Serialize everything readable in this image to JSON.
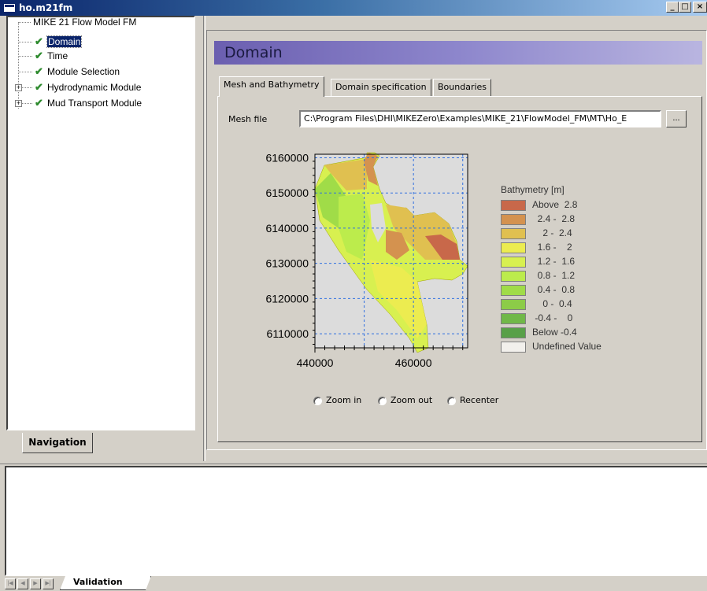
{
  "window": {
    "title": "ho.m21fm",
    "minimize": "_",
    "maximize": "□",
    "close": "×"
  },
  "nav": {
    "root": "MIKE 21 Flow Model FM",
    "items": [
      {
        "label": "Domain",
        "selected": true,
        "checked": true,
        "expandable": false
      },
      {
        "label": "Time",
        "selected": false,
        "checked": true,
        "expandable": false
      },
      {
        "label": "Module Selection",
        "selected": false,
        "checked": true,
        "expandable": false
      },
      {
        "label": "Hydrodynamic Module",
        "selected": false,
        "checked": true,
        "expandable": true
      },
      {
        "label": "Mud Transport Module",
        "selected": false,
        "checked": true,
        "expandable": true
      }
    ],
    "tab_label": "Navigation"
  },
  "main": {
    "header": "Domain",
    "tabs": [
      "Mesh and Bathymetry",
      "Domain specification",
      "Boundaries"
    ],
    "active_tab": 0,
    "mesh_file_label": "Mesh file",
    "mesh_file_value": "C:\\Program Files\\DHI\\MIKEZero\\Examples\\MIKE_21\\FlowModel_FM\\MT\\Ho_E",
    "browse_label": "...",
    "zoom_options": [
      "Zoom in",
      "Zoom out",
      "Recenter"
    ]
  },
  "chart_data": {
    "type": "heatmap",
    "title": "",
    "x_ticks": [
      440000,
      460000
    ],
    "x_tick_labels": [
      "440000",
      "460000"
    ],
    "y_ticks": [
      6110000,
      6120000,
      6130000,
      6140000,
      6150000,
      6160000
    ],
    "y_tick_labels": [
      "6110000",
      "6120000",
      "6130000",
      "6140000",
      "6150000",
      "6160000"
    ],
    "xlim": [
      440000,
      471000
    ],
    "ylim": [
      6106000,
      6161000
    ],
    "grid": true,
    "legend_title": "Bathymetry [m]",
    "legend_position": "right",
    "legend": [
      {
        "label": "Above  2.8",
        "color": "#c8684a"
      },
      {
        "label": "  2.4 -  2.8",
        "color": "#d4924f"
      },
      {
        "label": "    2 -  2.4",
        "color": "#e0c050"
      },
      {
        "label": "  1.6 -    2",
        "color": "#ecec50"
      },
      {
        "label": "  1.2 -  1.6",
        "color": "#d8f050"
      },
      {
        "label": "  0.8 -  1.2",
        "color": "#bcec4c"
      },
      {
        "label": "  0.4 -  0.8",
        "color": "#a0dc48"
      },
      {
        "label": "    0 -  0.4",
        "color": "#8ccc48"
      },
      {
        "label": " -0.4 -    0",
        "color": "#70b848"
      },
      {
        "label": "Below -0.4",
        "color": "#58a048"
      },
      {
        "label": "Undefined Value",
        "color": "#f2f0ec"
      }
    ]
  },
  "validation": {
    "tab_label": "Validation"
  }
}
